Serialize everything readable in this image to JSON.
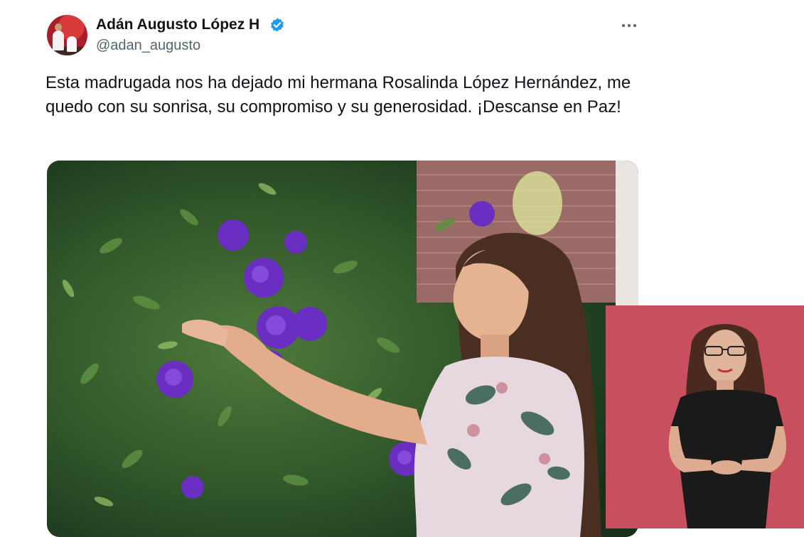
{
  "tweet": {
    "author": {
      "display_name": "Adán Augusto López H",
      "handle": "@adan_augusto",
      "verified": true
    },
    "text": "Esta madrugada nos ha dejado mi hermana Rosalinda López Hernández, me quedo con su sonrisa, su compromiso y su generosidad. ¡Descanse en Paz!",
    "media": {
      "type": "photo"
    }
  },
  "icons": {
    "verified": "verified-badge-icon",
    "more": "more-options-icon"
  },
  "colors": {
    "text_primary": "#0f1419",
    "text_secondary": "#536471",
    "verified_blue": "#1d9bf0",
    "sign_panel_bg": "#c8505e"
  },
  "overlay": {
    "type": "sign-language-interpreter-video"
  }
}
